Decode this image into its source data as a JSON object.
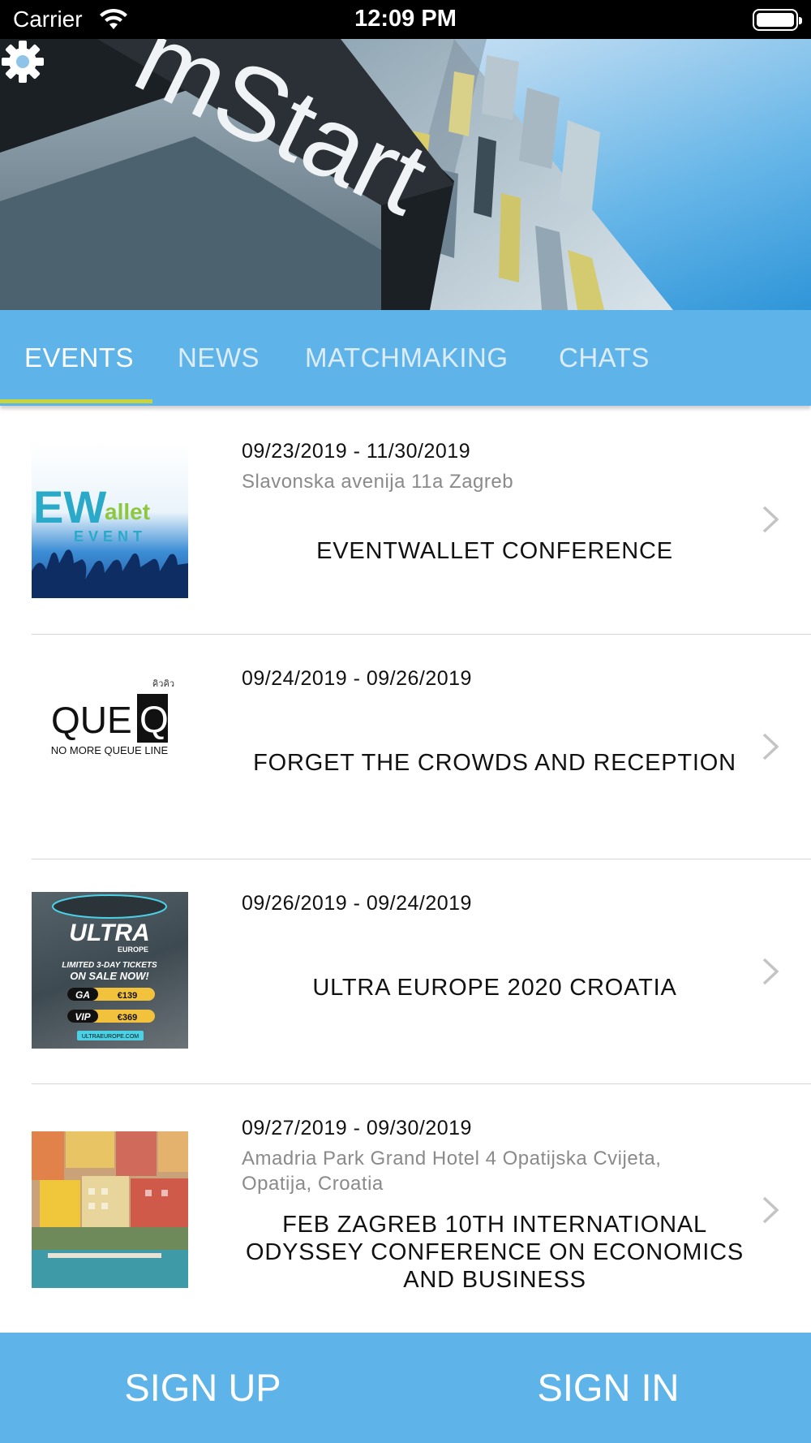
{
  "status_bar": {
    "carrier": "Carrier",
    "time": "12:09 PM",
    "wifi_icon": "wifi-icon",
    "battery_icon": "battery-icon"
  },
  "header": {
    "building_sign_text": "mStart",
    "settings_icon": "gear-icon"
  },
  "tabs": [
    {
      "label": "EVENTS",
      "active": true
    },
    {
      "label": "NEWS",
      "active": false
    },
    {
      "label": "MATCHMAKING",
      "active": false
    },
    {
      "label": "CHATS",
      "active": false
    }
  ],
  "events": [
    {
      "dates": "09/23/2019 - 11/30/2019",
      "address": "Slavonska avenija 11a Zagreb",
      "title": "EVENTWALLET CONFERENCE",
      "thumb_text": [
        "EW",
        "allet",
        "EVENT"
      ]
    },
    {
      "dates": "09/24/2019 - 09/26/2019",
      "address": "",
      "title": "FORGET THE CROWDS AND RECEPTION",
      "thumb_text": [
        "QUE",
        "Q",
        "คิวคิว",
        "NO MORE QUEUE LINE"
      ]
    },
    {
      "dates": "09/26/2019 - 09/24/2019",
      "address": "",
      "title": "ULTRA EUROPE 2020 CROATIA",
      "thumb_text": [
        "ULTRA",
        "EUROPE",
        "LIMITED 3-DAY TICKETS",
        "ON SALE NOW!",
        "GA",
        "€139",
        "VIP",
        "€369",
        "ULTRAEUROPE.COM"
      ]
    },
    {
      "dates": "09/27/2019 - 09/30/2019",
      "address": "Amadria Park Grand Hotel 4 Opatijska Cvijeta, Opatija, Croatia",
      "title": "FEB ZAGREB 10TH INTERNATIONAL ODYSSEY CONFERENCE ON ECONOMICS AND BUSINESS",
      "thumb_text": []
    }
  ],
  "bottom_bar": {
    "sign_up": "SIGN UP",
    "sign_in": "SIGN IN"
  },
  "colors": {
    "accent_blue": "#5eb4e9",
    "tab_indicator": "#c8d43a",
    "status_bar": "#000000"
  }
}
